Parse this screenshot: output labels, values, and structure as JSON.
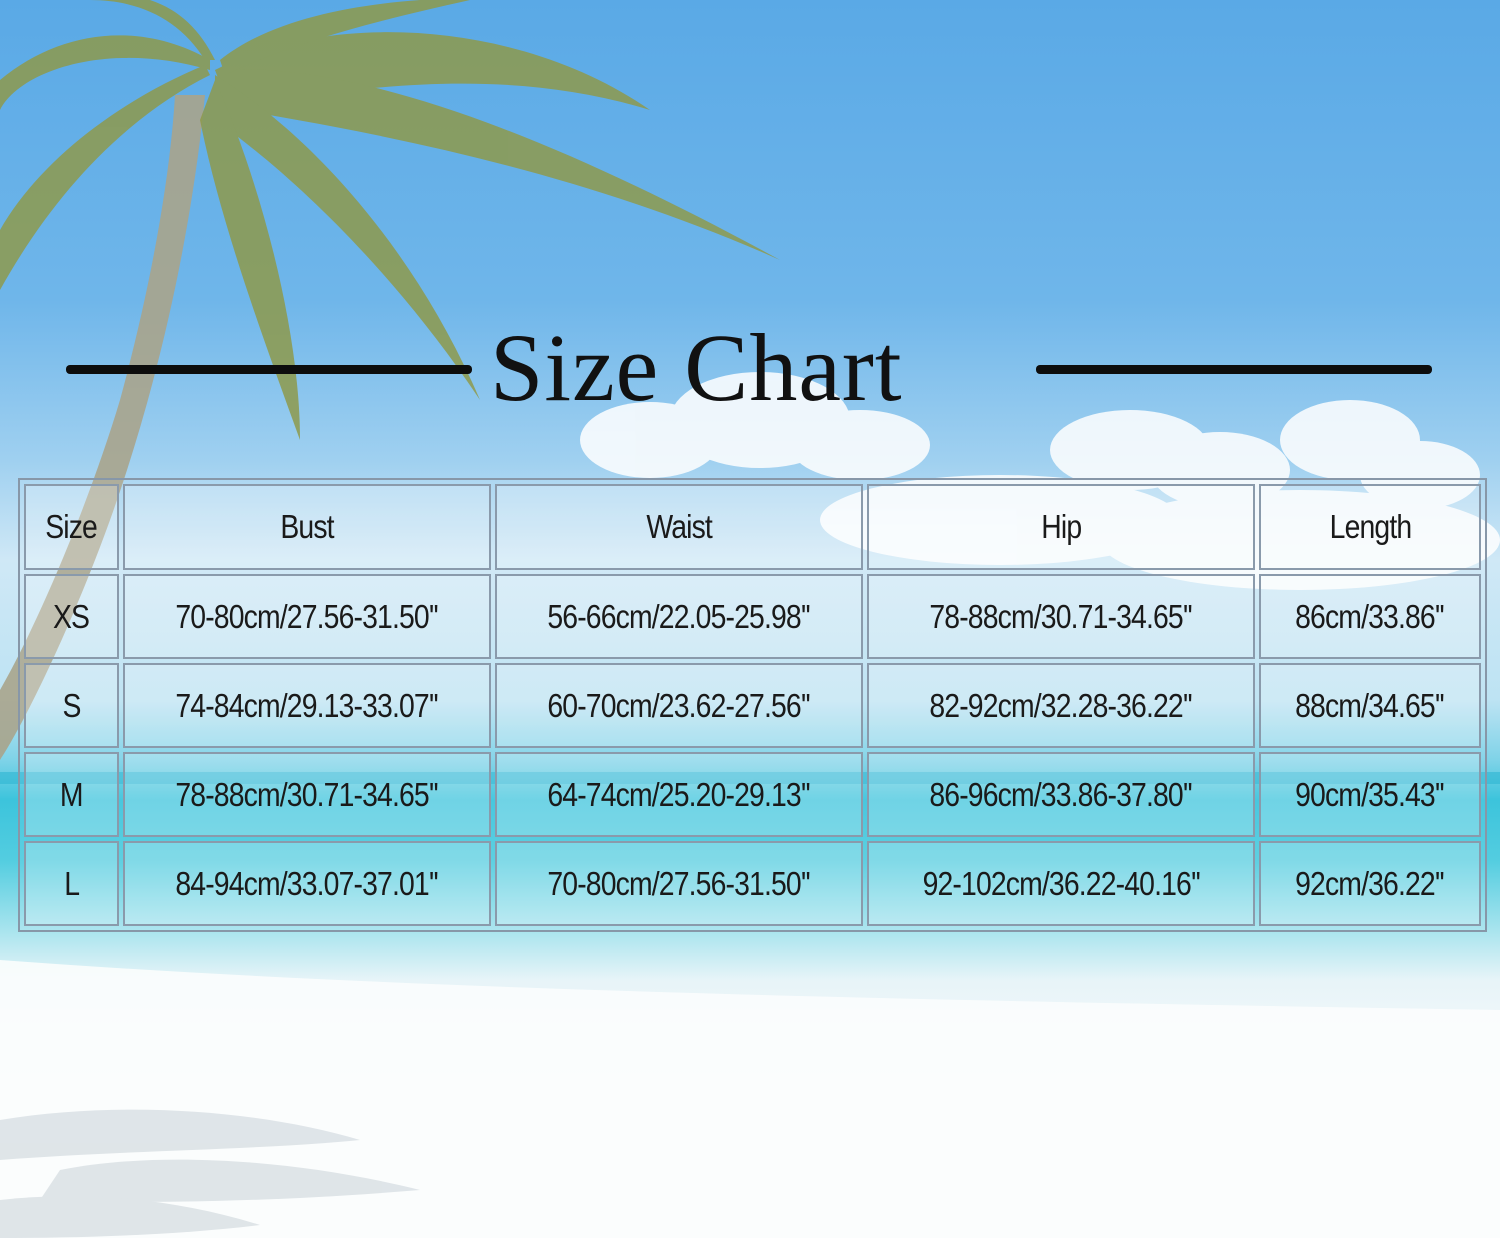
{
  "title": "Size Chart",
  "table": {
    "headers": [
      "Size",
      "Bust",
      "Waist",
      "Hip",
      "Length"
    ],
    "rows": [
      [
        "XS",
        "70-80cm/27.56-31.50''",
        "56-66cm/22.05-25.98''",
        "78-88cm/30.71-34.65''",
        "86cm/33.86''"
      ],
      [
        "S",
        "74-84cm/29.13-33.07''",
        "60-70cm/23.62-27.56''",
        "82-92cm/32.28-36.22''",
        "88cm/34.65''"
      ],
      [
        "M",
        "78-88cm/30.71-34.65''",
        "64-74cm/25.20-29.13''",
        "86-96cm/33.86-37.80''",
        "90cm/35.43''"
      ],
      [
        "L",
        "84-94cm/33.07-37.01''",
        "70-80cm/27.56-31.50''",
        "92-102cm/36.22-40.16''",
        "92cm/36.22''"
      ]
    ]
  },
  "colors": {
    "sky": "#5aa9e6",
    "sea": "#3cc4dc",
    "sand": "#ffffff",
    "palm_leaf": "#8f9f4a",
    "title_text": "#111111"
  }
}
